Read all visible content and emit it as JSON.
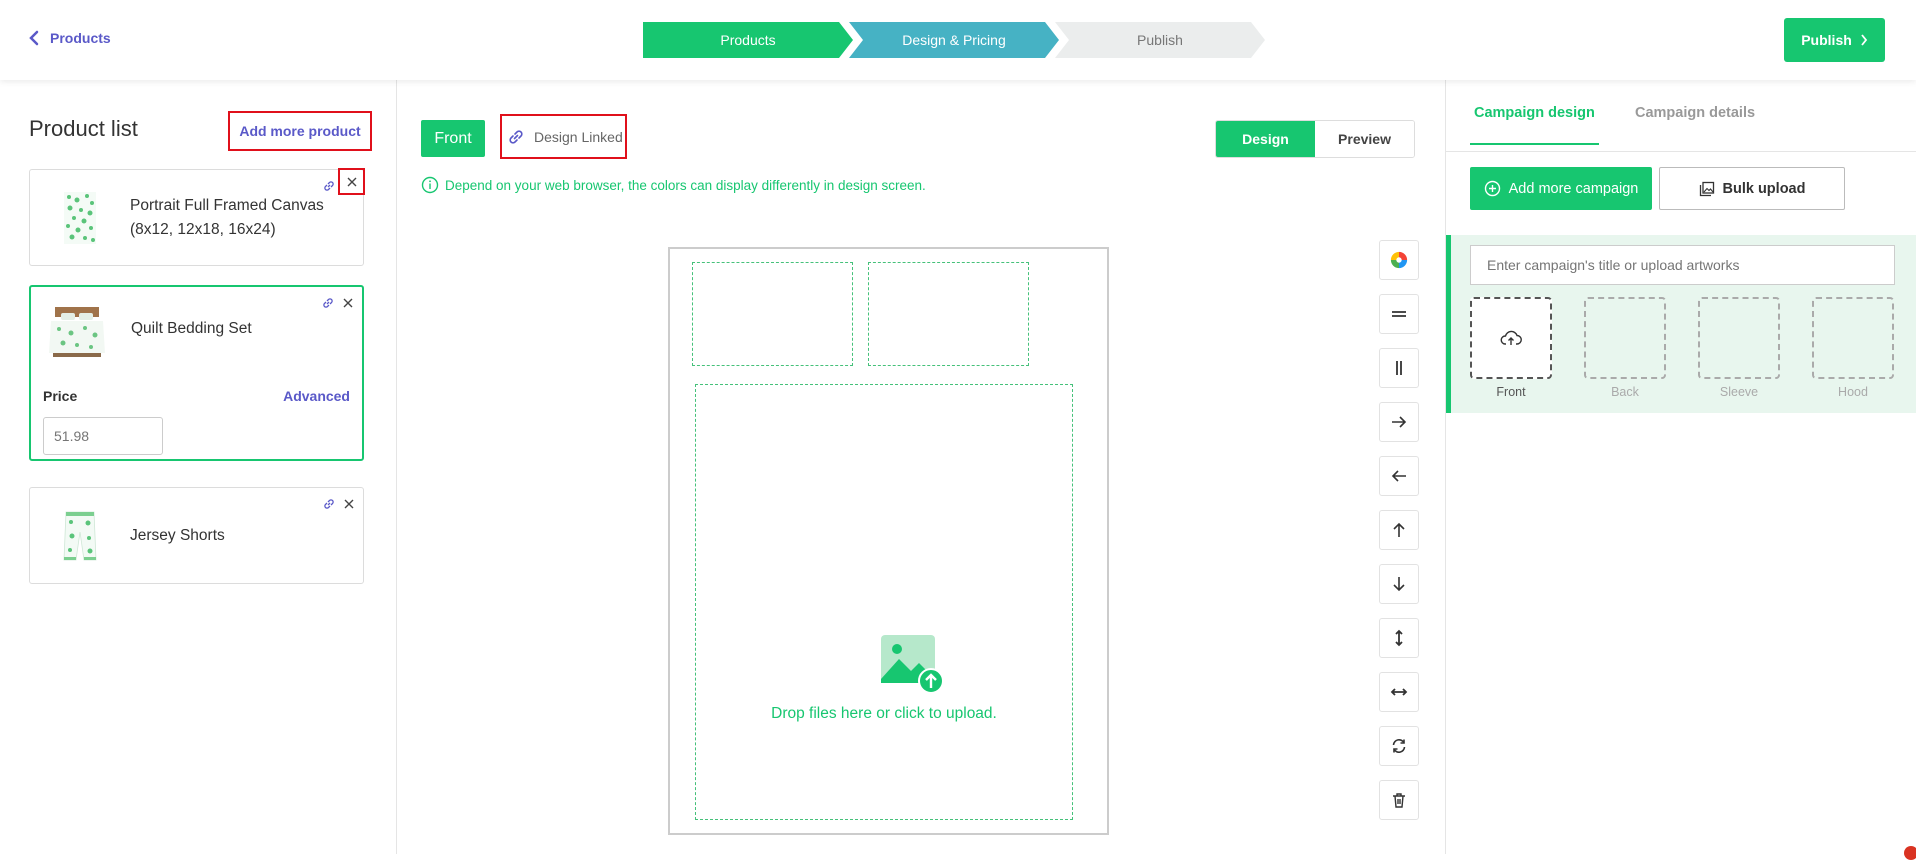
{
  "topbar": {
    "back_label": "Products",
    "steps": [
      "Products",
      "Design & Pricing",
      "Publish"
    ],
    "publish_label": "Publish"
  },
  "left": {
    "title": "Product list",
    "add_product_label": "Add more product",
    "products": [
      {
        "name_line1": "Portrait Full Framed Canvas",
        "name_line2": "(8x12, 12x18, 16x24)"
      },
      {
        "name": "Quilt Bedding Set",
        "price_label": "Price",
        "advanced_label": "Advanced",
        "price_placeholder": "51.98"
      },
      {
        "name": "Jersey Shorts"
      }
    ]
  },
  "center": {
    "side_label": "Front",
    "design_linked_label": "Design Linked",
    "mode_design": "Design",
    "mode_preview": "Preview",
    "notice": "Depend on your web browser, the colors can display differently in design screen.",
    "upload_text": "Drop files here or click to upload.",
    "tools": [
      "color-wheel-icon",
      "align-horizontal-icon",
      "align-vertical-icon",
      "arrow-right-icon",
      "arrow-left-icon",
      "arrow-up-icon",
      "arrow-down-icon",
      "stretch-vertical-icon",
      "stretch-horizontal-icon",
      "rotate-icon",
      "trash-icon"
    ]
  },
  "right": {
    "tab_design": "Campaign design",
    "tab_details": "Campaign details",
    "add_campaign_label": "Add more campaign",
    "bulk_upload_label": "Bulk upload",
    "campaign_placeholder": "Enter campaign's title or upload artworks",
    "slots": [
      "Front",
      "Back",
      "Sleeve",
      "Hood"
    ]
  },
  "colors": {
    "green": "#17c670",
    "teal": "#46b2c4",
    "purple": "#5a59c8",
    "highlight_red": "#e0101b"
  }
}
